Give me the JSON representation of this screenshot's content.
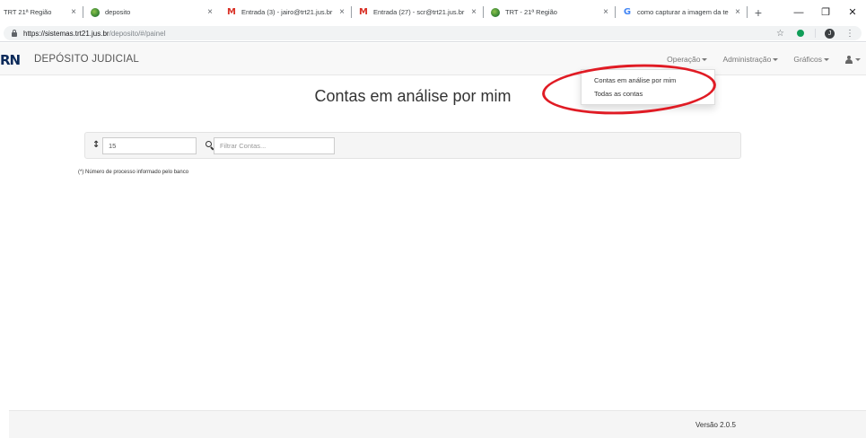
{
  "browser": {
    "tabs": [
      {
        "title": "TRT 21ª Região",
        "favicon": "none"
      },
      {
        "title": "deposito",
        "favicon": "green-seal-icon"
      },
      {
        "title": "Entrada (3) - jairo@trt21.jus.br",
        "favicon": "gmail-icon"
      },
      {
        "title": "Entrada (27) - scr@trt21.jus.br",
        "favicon": "gmail-icon"
      },
      {
        "title": "TRT - 21ª Região",
        "favicon": "green-seal-icon"
      },
      {
        "title": "como capturar a imagem da te",
        "favicon": "google-icon"
      }
    ],
    "close_glyph": "×",
    "new_tab_glyph": "+",
    "window_controls": {
      "minimize": "—",
      "restore": "❐",
      "close": "✕"
    },
    "address": {
      "host": "https://sistemas.trt21.jus.br",
      "path": "/deposito/#/painel"
    },
    "profile_initial": "J",
    "menu_glyph": "⋮",
    "bookmark_glyph": "☆"
  },
  "navbar": {
    "logo": "RN",
    "brand": "DEPÓSITO JUDICIAL",
    "menus": [
      {
        "label": "Operação"
      },
      {
        "label": "Administração"
      },
      {
        "label": "Gráficos"
      }
    ]
  },
  "dropdown": {
    "items": [
      {
        "label": "Contas em análise por mim"
      },
      {
        "label": "Todas as contas"
      }
    ]
  },
  "main": {
    "title": "Contas em análise por mim",
    "sort_glyph": "↕",
    "page_size_value": "15",
    "filter_placeholder": "Filtrar Contas...",
    "footnote": "(*) Número de processo informado pelo banco"
  },
  "footer": {
    "version": "Versão 2.0.5"
  },
  "colors": {
    "annotation": "#e01b24",
    "brand_logo": "#0b2a5a",
    "navbar_bg": "#f8f8f8"
  }
}
